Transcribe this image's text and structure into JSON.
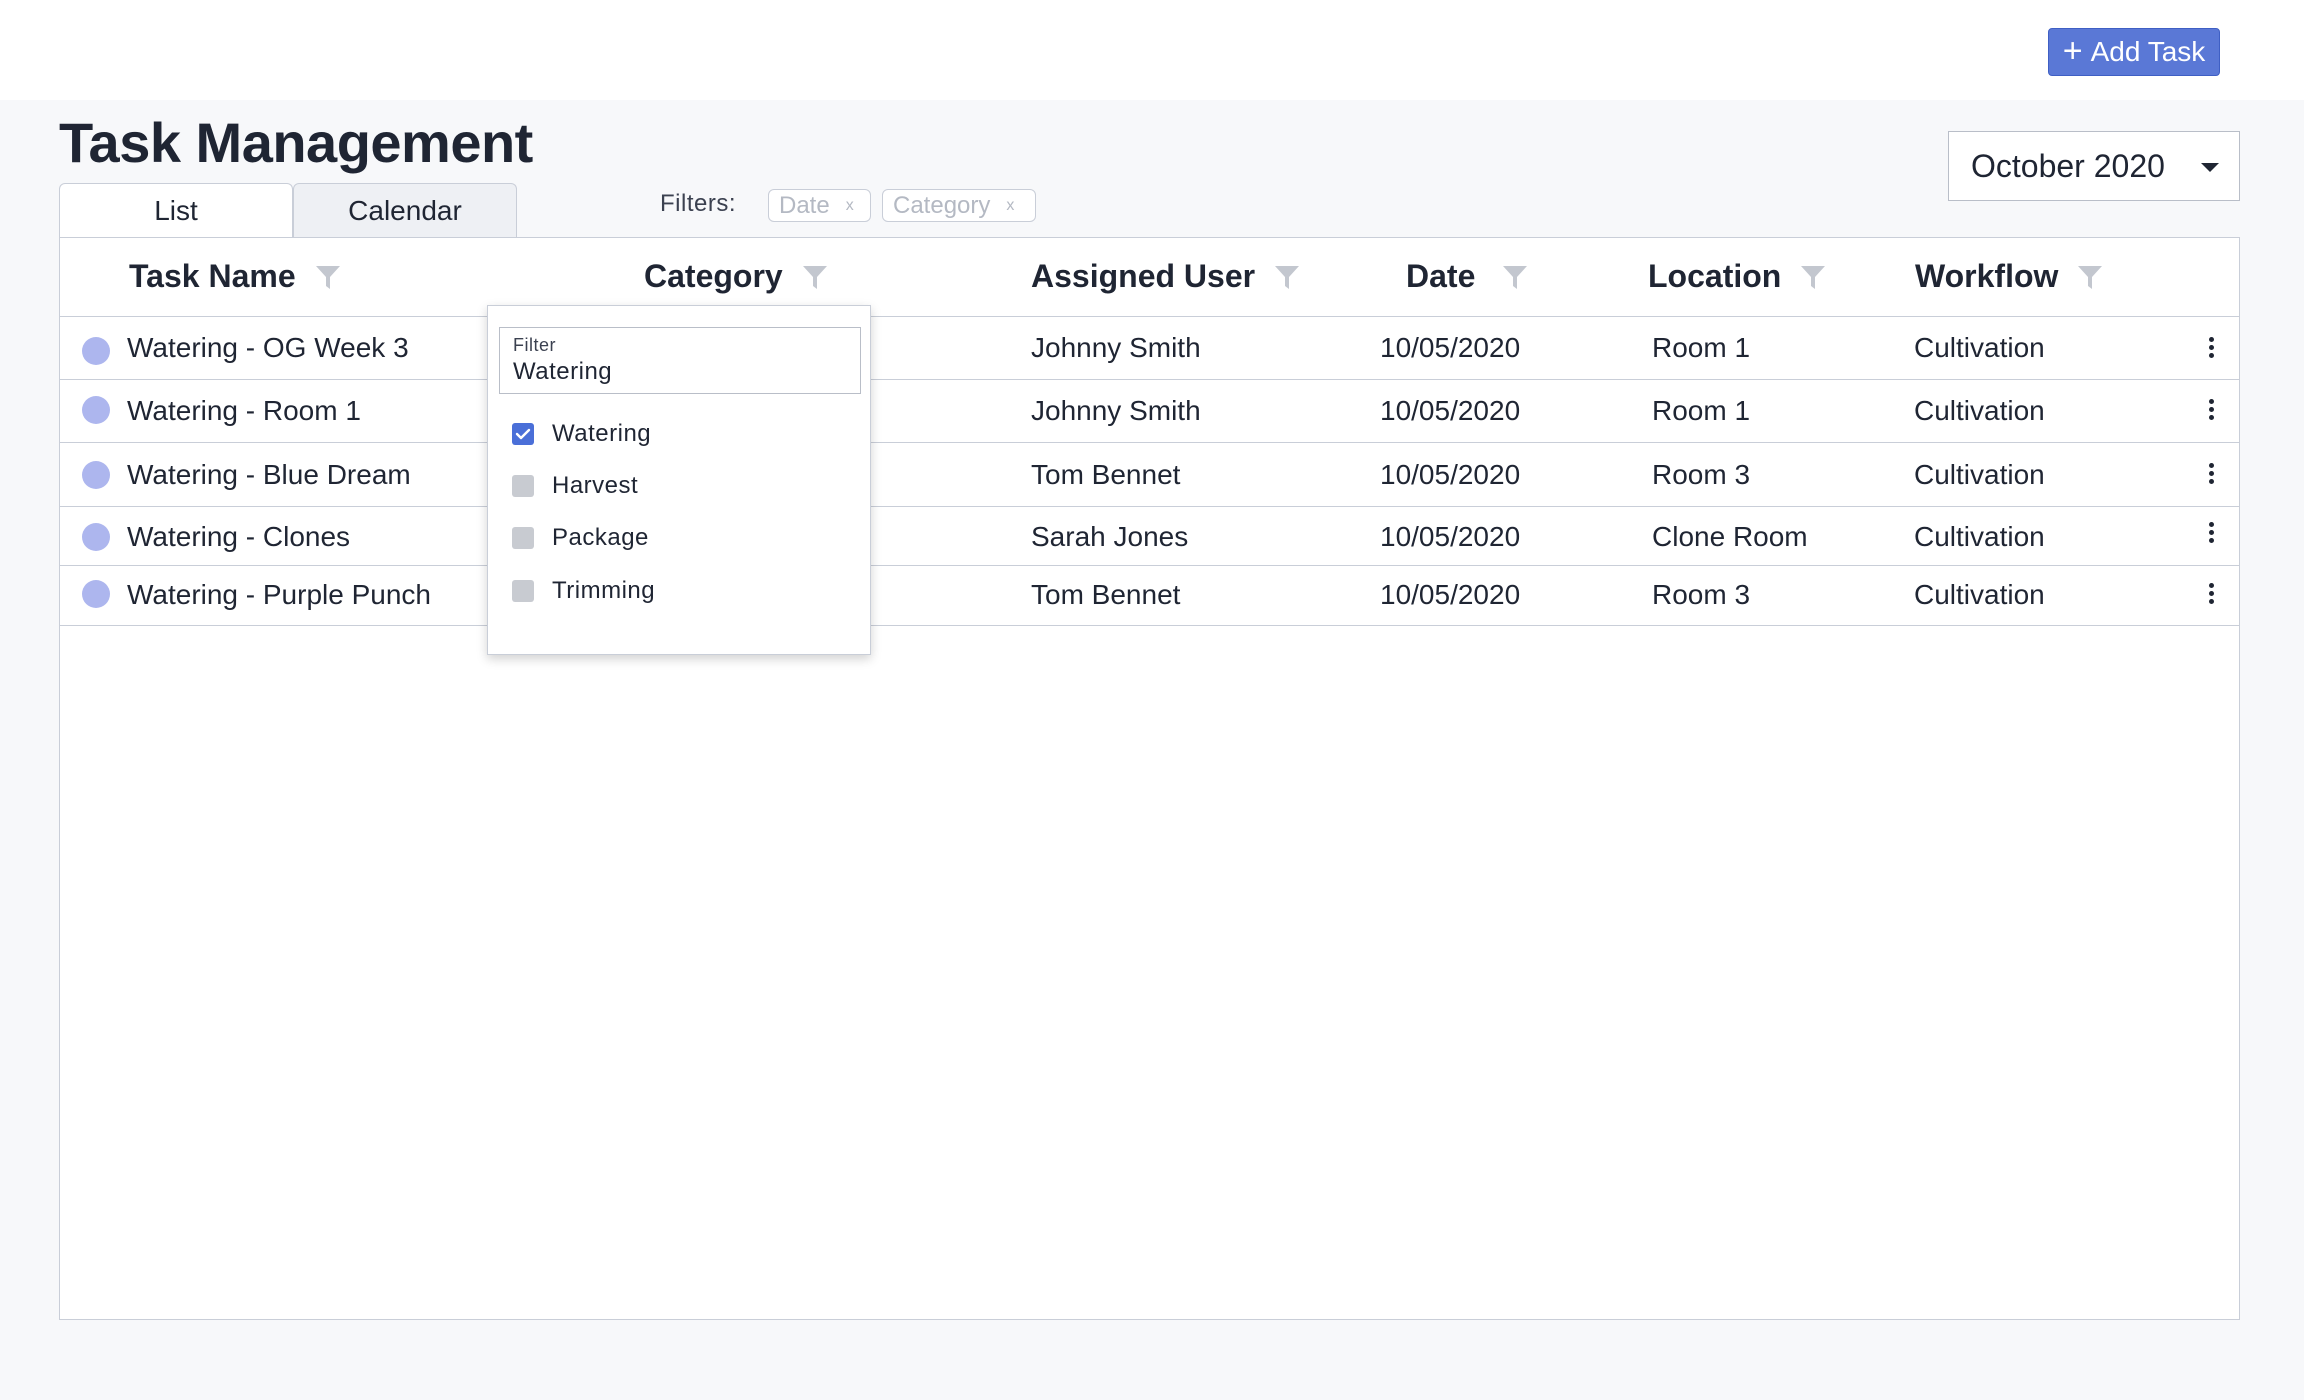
{
  "header": {
    "add_task_label": "Add Task",
    "title": "Task Management"
  },
  "tabs": [
    {
      "label": "List",
      "active": true
    },
    {
      "label": "Calendar",
      "active": false
    }
  ],
  "filters": {
    "label": "Filters:",
    "chips": [
      {
        "label": "Date",
        "remove": "x"
      },
      {
        "label": "Category",
        "remove": "x"
      }
    ]
  },
  "month_select": {
    "value": "October 2020"
  },
  "table": {
    "columns": [
      {
        "label": "Task Name"
      },
      {
        "label": "Category"
      },
      {
        "label": "Assigned User"
      },
      {
        "label": "Date"
      },
      {
        "label": "Location"
      },
      {
        "label": "Workflow"
      }
    ],
    "rows": [
      {
        "task": "Watering - OG Week 3",
        "user": "Johnny Smith",
        "date": "10/05/2020",
        "location": "Room 1",
        "workflow": "Cultivation"
      },
      {
        "task": "Watering - Room 1",
        "user": "Johnny Smith",
        "date": "10/05/2020",
        "location": "Room 1",
        "workflow": "Cultivation"
      },
      {
        "task": "Watering - Blue Dream",
        "user": "Tom Bennet",
        "date": "10/05/2020",
        "location": "Room 3",
        "workflow": "Cultivation"
      },
      {
        "task": "Watering - Clones",
        "user": "Sarah Jones",
        "date": "10/05/2020",
        "location": "Clone Room",
        "workflow": "Cultivation"
      },
      {
        "task": "Watering - Purple Punch",
        "user": "Tom Bennet",
        "date": "10/05/2020",
        "location": "Room 3",
        "workflow": "Cultivation"
      }
    ]
  },
  "category_dropdown": {
    "filter_label": "Filter",
    "filter_value": "Watering",
    "options": [
      {
        "label": "Watering",
        "checked": true
      },
      {
        "label": "Harvest",
        "checked": false
      },
      {
        "label": "Package",
        "checked": false
      },
      {
        "label": "Trimming",
        "checked": false
      }
    ]
  },
  "colors": {
    "accent": "#5a78d6",
    "status_dot": "#adb6ee",
    "checkbox_checked": "#4a6fd8"
  }
}
